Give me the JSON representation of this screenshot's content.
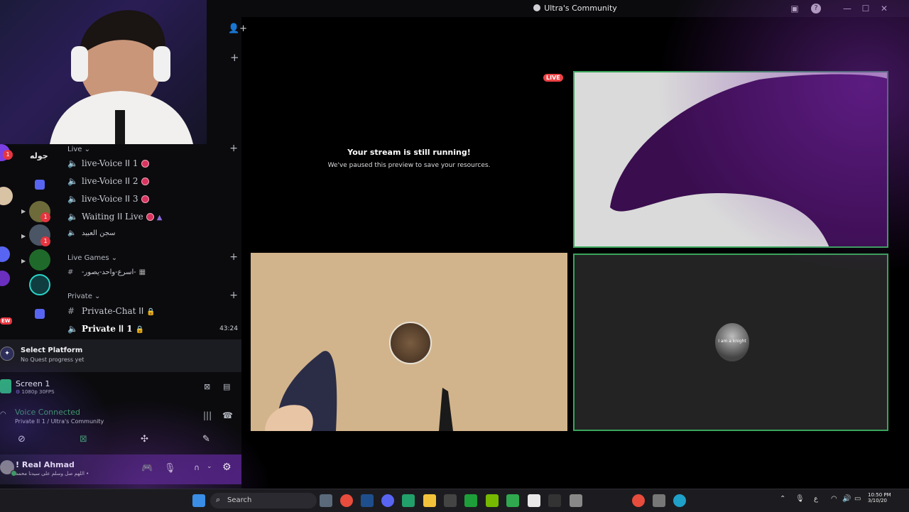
{
  "window": {
    "title": "Ultra's Community",
    "inbox_icon": "inbox-icon",
    "help_icon": "help-icon",
    "minimize_icon": "minimize-icon",
    "maximize_icon": "maximize-icon",
    "close_icon": "close-icon"
  },
  "server_rail": {
    "server_name_label": "جوله",
    "badges": [
      "1",
      "1",
      "1"
    ],
    "new_badge": "EW"
  },
  "channels": {
    "live_category": "Live",
    "voice": [
      {
        "name": "live-Voice ꓲꓲ 1"
      },
      {
        "name": "live-Voice ꓲꓲ 2"
      },
      {
        "name": "live-Voice ꓲꓲ 3"
      },
      {
        "name": "Waiting ꓲꓲ Live"
      },
      {
        "name": "سجن العبيد"
      }
    ],
    "live_games_category": "Live Games",
    "live_games_channel": "-اسرع-واحد-يصور-",
    "private_category": "Private",
    "private_chat": "Private-Chat ꓲꓲ",
    "private_voice": "Private ꓲꓲ 1",
    "private_voice_time": "43:24"
  },
  "quest": {
    "title": "Select Platform",
    "subtitle": "No Quest progress yet"
  },
  "screen_share": {
    "title": "Screen 1",
    "quality": "1080p 30FPS"
  },
  "voice_status": {
    "title": "Voice Connected",
    "location": "Private ꓲꓲ 1 / Ultra's Community"
  },
  "user": {
    "name": "! Real Ahmad",
    "status": "اللهم صل وسلم على سيدنا محمد •"
  },
  "stage": {
    "live_badge": "LIVE",
    "paused_title": "Your stream is still running!",
    "paused_sub": "We've paused this preview to save your resources.",
    "tileC_label": "I am a knight"
  },
  "taskbar": {
    "search_placeholder": "Search",
    "time": "10:50 PM",
    "date": "3/10/20",
    "lang": "ع"
  },
  "colors": {
    "accent_green": "#3ba55c",
    "live_red": "#ed4245",
    "brand_purple": "#5865f2"
  }
}
